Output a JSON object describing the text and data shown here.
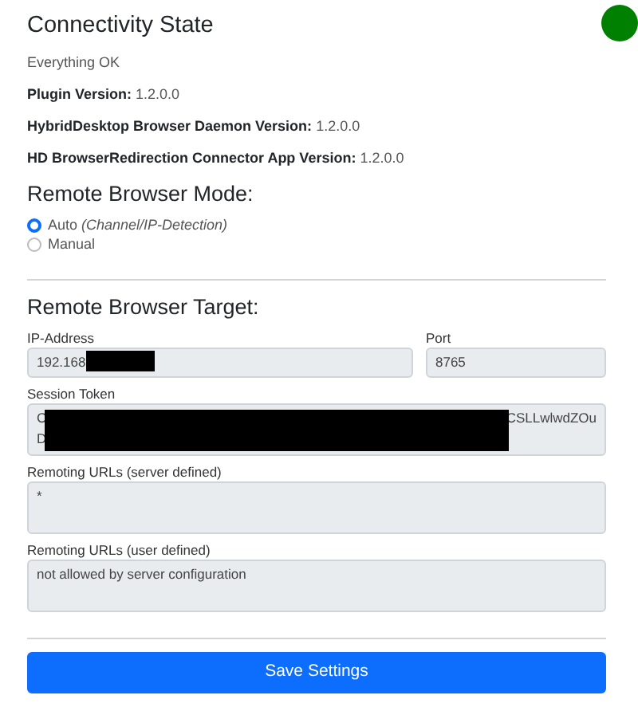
{
  "connectivity": {
    "title": "Connectivity State",
    "status": "Everything OK",
    "ok": true,
    "versions": [
      {
        "label": "Plugin Version:",
        "value": "1.2.0.0"
      },
      {
        "label": "HybridDesktop Browser Daemon Version:",
        "value": "1.2.0.0"
      },
      {
        "label": "HD BrowserRedirection Connector App Version:",
        "value": "1.2.0.0"
      }
    ]
  },
  "mode": {
    "title": "Remote Browser Mode:",
    "options": [
      {
        "label": "Auto",
        "note": "(Channel/IP-Detection)",
        "selected": true
      },
      {
        "label": "Manual",
        "selected": false
      }
    ]
  },
  "target": {
    "title": "Remote Browser Target:",
    "ip": {
      "label": "IP-Address",
      "value": "192.168",
      "redacted": true
    },
    "port": {
      "label": "Port",
      "value": "8765"
    },
    "token": {
      "label": "Session Token",
      "line1_start": "C",
      "line1_end": "CSLLwlwdZOu",
      "line2_start": "D",
      "redacted": true
    },
    "server_urls": {
      "label": "Remoting URLs (server defined)",
      "value": "*"
    },
    "user_urls": {
      "label": "Remoting URLs (user defined)",
      "value": "not allowed by server configuration"
    }
  },
  "save_button": "Save Settings"
}
